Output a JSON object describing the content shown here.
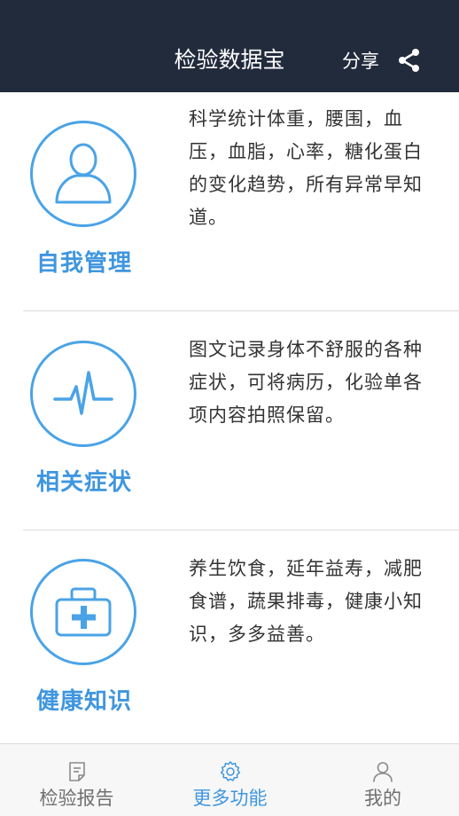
{
  "header": {
    "title": "检验数据宝",
    "share_label": "分享"
  },
  "features": [
    {
      "name": "自我管理",
      "icon": "user-icon",
      "description": "科学统计体重，腰围，血压，血脂，心率，糖化蛋白的变化趋势，所有异常早知道。"
    },
    {
      "name": "相关症状",
      "icon": "heartbeat-icon",
      "description": "图文记录身体不舒服的各种症状，可将病历，化验单各项内容拍照保留。"
    },
    {
      "name": "健康知识",
      "icon": "medical-kit-icon",
      "description": "养生饮食，延年益寿，减肥食谱，蔬果排毒，健康小知识，多多益善。"
    }
  ],
  "tabbar": {
    "items": [
      {
        "label": "检验报告",
        "icon": "report-icon",
        "active": false
      },
      {
        "label": "更多功能",
        "icon": "gear-icon",
        "active": true
      },
      {
        "label": "我的",
        "icon": "profile-icon",
        "active": false
      }
    ]
  },
  "colors": {
    "header_bg": "#222b3c",
    "accent": "#3f96df",
    "text": "#333333"
  }
}
